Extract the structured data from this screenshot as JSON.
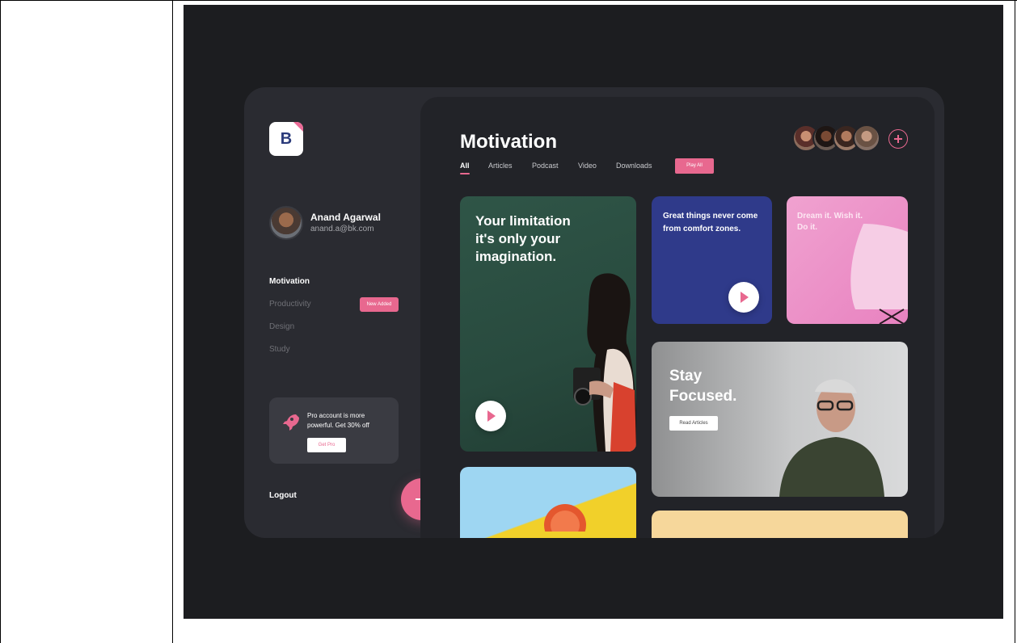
{
  "brand": {
    "logo_letter": "B"
  },
  "user": {
    "name": "Anand Agarwal",
    "email": "anand.a@bk.com"
  },
  "nav": {
    "items": [
      {
        "label": "Motivation",
        "active": true
      },
      {
        "label": "Productivity",
        "active": false
      },
      {
        "label": "Design",
        "active": false
      },
      {
        "label": "Study",
        "active": false
      }
    ],
    "badge": "New Added"
  },
  "promo": {
    "text": "Pro account is more powerful. Get 30% off",
    "button": "Get Pro"
  },
  "logout": "Logout",
  "header": {
    "title": "Motivation",
    "tabs": [
      "All",
      "Articles",
      "Podcast",
      "Video",
      "Downloads"
    ],
    "play_all": "Play All"
  },
  "cards": {
    "limitation": "Your limitation it's only your imagination.",
    "great_things": "Great things never come from comfort zones.",
    "dream": "Dream it. Wish it. Do it.",
    "stay_focused": "Stay Focused.",
    "read_articles": "Read Articles"
  },
  "colors": {
    "accent": "#e8688f",
    "panel": "#2a2b31",
    "content": "#222328",
    "navy": "#2f3a8a"
  },
  "icons": [
    "rocket-icon",
    "plus-icon",
    "play-icon",
    "add-person-icon"
  ]
}
